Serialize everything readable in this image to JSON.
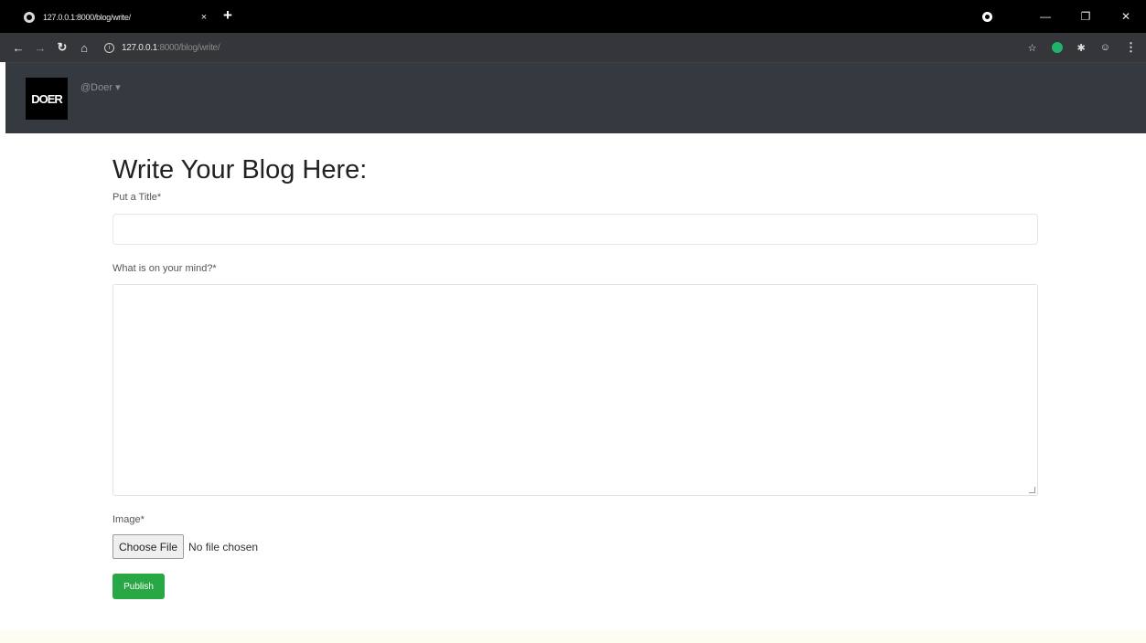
{
  "browser": {
    "tab_title": "127.0.0.1:8000/blog/write/",
    "tab_close": "×",
    "new_tab": "+",
    "url_host": "127.0.0.1",
    "url_path": ":8000/blog/write/",
    "window_controls": {
      "minimize": "—",
      "maximize": "❐",
      "close": "✕"
    }
  },
  "navbar": {
    "logo_text": "DOER",
    "user_menu": "@Doer ▾"
  },
  "form": {
    "heading": "Write Your Blog Here:",
    "title_label": "Put a Title*",
    "mind_label": "What is on your mind?*",
    "image_label": "Image*",
    "choose_file": "Choose File",
    "no_file": "No file chosen",
    "publish": "Publish"
  },
  "colors": {
    "navbar_bg": "#343a40",
    "publish_bg": "#28a745"
  }
}
